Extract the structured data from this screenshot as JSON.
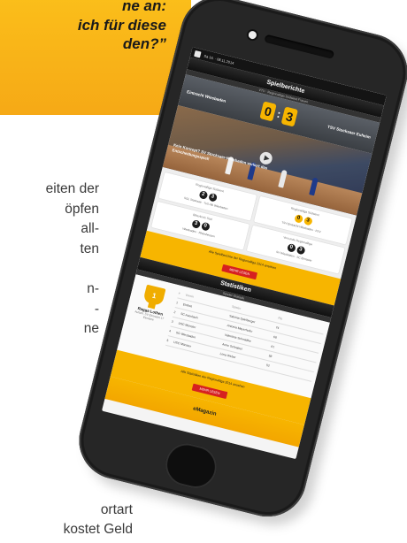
{
  "quote": {
    "text": "ne an:\nich für diese\nden?”"
  },
  "body_lines": [
    "eiten der",
    "öpfen",
    "all-",
    "ten",
    "",
    "n-",
    "-",
    "ne"
  ],
  "footer_lines": [
    "ortart",
    "kostet Geld"
  ],
  "phone": {
    "topbar_date": "Sa 16. · 08.11.2014",
    "spielberichte": {
      "title": "Spielberichte",
      "subtitle": "VTV · Regionalliga Südwest Frauen",
      "home_team": "Eintracht Wiesbaden",
      "away_team": "TSV Stocksaer Euheim",
      "home_score": "0",
      "away_score": "3",
      "video_caption": "Kein Konzept? SV Stocksaer-Wiesbaden verliert das Entscheidungsspiel!",
      "cards": [
        {
          "league": "Regionalliga Südwest",
          "home": "2",
          "away": "3",
          "teams": "SGL Stocksae · TuS Alb Wiesbaden"
        },
        {
          "league": "Regionalliga Südwest",
          "home": "0",
          "away": "3",
          "teams": "TSV Eintracht Wiesbaden · FSV"
        },
        {
          "league": "Bitterkreis Süd",
          "home": "3",
          "away": "0",
          "teams": "Wiesbaden · Rheinhessen"
        },
        {
          "league": "Vorrunde Regionalliga",
          "home": "0",
          "away": "3",
          "teams": "SV Wiesbaden · SC Elmstein"
        }
      ],
      "band_text": "Alle Spielberichte der Regionalliga 2014 ansehen",
      "band_button": "MEHR LESEN"
    },
    "statistiken": {
      "title": "Statistiken",
      "subtitle": "Spieler-Statistik",
      "trophy_number": "1",
      "player_name": "Ragga Lothen",
      "player_info": "Aufsch. SV Eintracht 17 Einsätze",
      "table_head": [
        "#",
        "Verein",
        "Spieler",
        "Pkt"
      ],
      "rows": [
        [
          "1",
          "Einheit",
          "Sabrina Spielberger",
          "74"
        ],
        [
          "2",
          "SC Auerbach",
          "Antonia Mayerhofer",
          "68"
        ],
        [
          "3",
          "USC Münster",
          "Valentina Schmidtke",
          "61"
        ],
        [
          "4",
          "SG Wiesbaden",
          "Anne Schnabel",
          "58"
        ],
        [
          "5",
          "USC Münster",
          "Lena Weber",
          "52"
        ]
      ],
      "band_text": "Alle Statistiken der Regionalliga 2014 ansehen",
      "band_button": "MEHR LESEN"
    },
    "emagazin_label": "eMagazin"
  }
}
